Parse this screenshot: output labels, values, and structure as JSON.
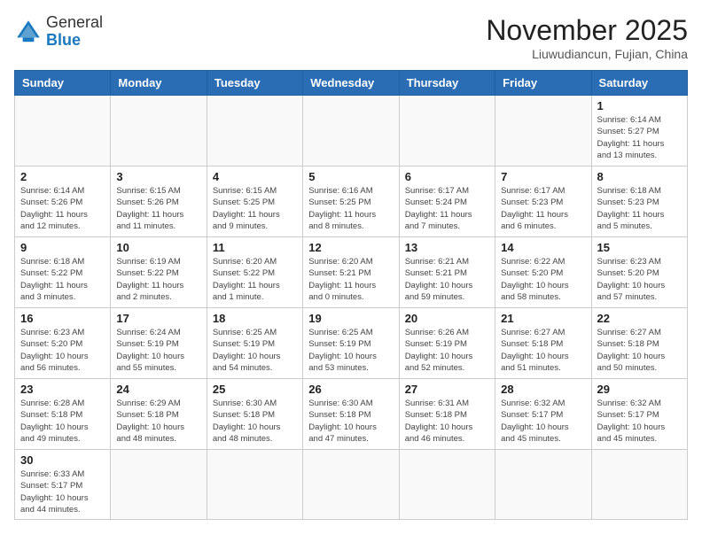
{
  "header": {
    "logo_general": "General",
    "logo_blue": "Blue",
    "month_title": "November 2025",
    "location": "Liuwudiancun, Fujian, China"
  },
  "weekdays": [
    "Sunday",
    "Monday",
    "Tuesday",
    "Wednesday",
    "Thursday",
    "Friday",
    "Saturday"
  ],
  "days": {
    "1": {
      "sunrise": "6:14 AM",
      "sunset": "5:27 PM",
      "daylight": "11 hours and 13 minutes."
    },
    "2": {
      "sunrise": "6:14 AM",
      "sunset": "5:26 PM",
      "daylight": "11 hours and 12 minutes."
    },
    "3": {
      "sunrise": "6:15 AM",
      "sunset": "5:26 PM",
      "daylight": "11 hours and 11 minutes."
    },
    "4": {
      "sunrise": "6:15 AM",
      "sunset": "5:25 PM",
      "daylight": "11 hours and 9 minutes."
    },
    "5": {
      "sunrise": "6:16 AM",
      "sunset": "5:25 PM",
      "daylight": "11 hours and 8 minutes."
    },
    "6": {
      "sunrise": "6:17 AM",
      "sunset": "5:24 PM",
      "daylight": "11 hours and 7 minutes."
    },
    "7": {
      "sunrise": "6:17 AM",
      "sunset": "5:23 PM",
      "daylight": "11 hours and 6 minutes."
    },
    "8": {
      "sunrise": "6:18 AM",
      "sunset": "5:23 PM",
      "daylight": "11 hours and 5 minutes."
    },
    "9": {
      "sunrise": "6:18 AM",
      "sunset": "5:22 PM",
      "daylight": "11 hours and 3 minutes."
    },
    "10": {
      "sunrise": "6:19 AM",
      "sunset": "5:22 PM",
      "daylight": "11 hours and 2 minutes."
    },
    "11": {
      "sunrise": "6:20 AM",
      "sunset": "5:22 PM",
      "daylight": "11 hours and 1 minute."
    },
    "12": {
      "sunrise": "6:20 AM",
      "sunset": "5:21 PM",
      "daylight": "11 hours and 0 minutes."
    },
    "13": {
      "sunrise": "6:21 AM",
      "sunset": "5:21 PM",
      "daylight": "10 hours and 59 minutes."
    },
    "14": {
      "sunrise": "6:22 AM",
      "sunset": "5:20 PM",
      "daylight": "10 hours and 58 minutes."
    },
    "15": {
      "sunrise": "6:23 AM",
      "sunset": "5:20 PM",
      "daylight": "10 hours and 57 minutes."
    },
    "16": {
      "sunrise": "6:23 AM",
      "sunset": "5:20 PM",
      "daylight": "10 hours and 56 minutes."
    },
    "17": {
      "sunrise": "6:24 AM",
      "sunset": "5:19 PM",
      "daylight": "10 hours and 55 minutes."
    },
    "18": {
      "sunrise": "6:25 AM",
      "sunset": "5:19 PM",
      "daylight": "10 hours and 54 minutes."
    },
    "19": {
      "sunrise": "6:25 AM",
      "sunset": "5:19 PM",
      "daylight": "10 hours and 53 minutes."
    },
    "20": {
      "sunrise": "6:26 AM",
      "sunset": "5:19 PM",
      "daylight": "10 hours and 52 minutes."
    },
    "21": {
      "sunrise": "6:27 AM",
      "sunset": "5:18 PM",
      "daylight": "10 hours and 51 minutes."
    },
    "22": {
      "sunrise": "6:27 AM",
      "sunset": "5:18 PM",
      "daylight": "10 hours and 50 minutes."
    },
    "23": {
      "sunrise": "6:28 AM",
      "sunset": "5:18 PM",
      "daylight": "10 hours and 49 minutes."
    },
    "24": {
      "sunrise": "6:29 AM",
      "sunset": "5:18 PM",
      "daylight": "10 hours and 48 minutes."
    },
    "25": {
      "sunrise": "6:30 AM",
      "sunset": "5:18 PM",
      "daylight": "10 hours and 48 minutes."
    },
    "26": {
      "sunrise": "6:30 AM",
      "sunset": "5:18 PM",
      "daylight": "10 hours and 47 minutes."
    },
    "27": {
      "sunrise": "6:31 AM",
      "sunset": "5:18 PM",
      "daylight": "10 hours and 46 minutes."
    },
    "28": {
      "sunrise": "6:32 AM",
      "sunset": "5:17 PM",
      "daylight": "10 hours and 45 minutes."
    },
    "29": {
      "sunrise": "6:32 AM",
      "sunset": "5:17 PM",
      "daylight": "10 hours and 45 minutes."
    },
    "30": {
      "sunrise": "6:33 AM",
      "sunset": "5:17 PM",
      "daylight": "10 hours and 44 minutes."
    }
  }
}
